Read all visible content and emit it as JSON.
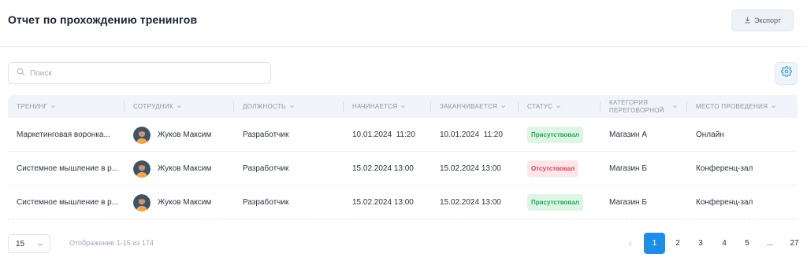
{
  "header": {
    "title": "Отчет по прохождению тренингов",
    "export_label": "Экспорт"
  },
  "search": {
    "placeholder": "Поиск",
    "value": ""
  },
  "icons": {
    "export": "download-icon",
    "search": "search-icon",
    "settings": "gear-icon",
    "sort": "chevron-down-icon"
  },
  "colors": {
    "accent": "#1e8ee8",
    "status_present_bg": "#dcf5e4",
    "status_present_text": "#26a65b",
    "status_absent_bg": "#fde6ea",
    "status_absent_text": "#e0405a"
  },
  "table": {
    "columns": [
      {
        "label": "Тренинг"
      },
      {
        "label": "Сотрудник"
      },
      {
        "label": "Должность"
      },
      {
        "label": "Начинается"
      },
      {
        "label": "Заканчивается"
      },
      {
        "label": "Статус"
      },
      {
        "label": "Категория переговорной"
      },
      {
        "label": "Место проведения"
      }
    ],
    "rows": [
      {
        "training": "Маркетинговая воронка...",
        "employee": "Жуков Максим",
        "position": "Разработчик",
        "start": "10.01.2024  11:20",
        "end": "10.01.2024  11:20",
        "status": "Присутствовал",
        "status_kind": "ok",
        "category": "Магазин А",
        "place": "Онлайн"
      },
      {
        "training": "Системное мышление в р...",
        "employee": "Жуков Максим",
        "position": "Разработчик",
        "start": "15.02.2024 13:00",
        "end": "15.02.2024 13:00",
        "status": "Отсутствовал",
        "status_kind": "bad",
        "category": "Магазин Б",
        "place": "Конференц-зал"
      },
      {
        "training": "Системное мышление в р...",
        "employee": "Жуков Максим",
        "position": "Разработчик",
        "start": "15.02.2024 13:00",
        "end": "15.02.2024 13:00",
        "status": "Присутствовал",
        "status_kind": "ok",
        "category": "Магазин Б",
        "place": "Конференц-зал"
      }
    ]
  },
  "footer": {
    "page_size": "15",
    "info": "Отображение 1-15 из 174"
  },
  "pagination": {
    "pages": [
      "1",
      "2",
      "3",
      "4",
      "5",
      "...",
      "27"
    ],
    "current": "1"
  }
}
